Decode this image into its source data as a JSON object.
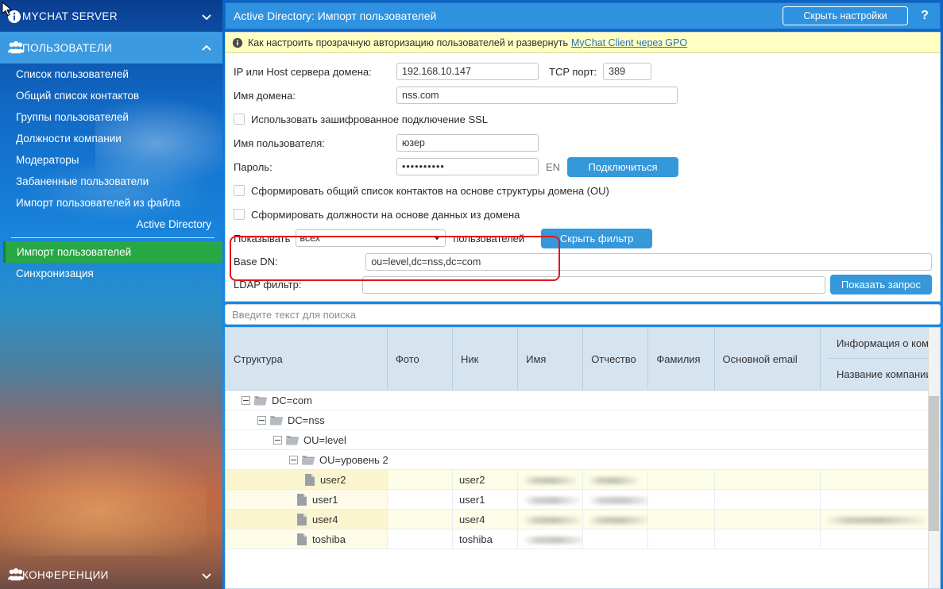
{
  "sidebar": {
    "server": {
      "label": "MYCHAT SERVER",
      "icon": "info-icon",
      "chevron": "chevron-down-icon"
    },
    "users_section": {
      "label": "ПОЛЬЗОВАТЕЛИ",
      "icon": "users-icon",
      "chevron": "chevron-up-icon"
    },
    "items": [
      {
        "label": "Список пользователей"
      },
      {
        "label": "Общий список контактов"
      },
      {
        "label": "Группы пользователей"
      },
      {
        "label": "Должности компании"
      },
      {
        "label": "Модераторы"
      },
      {
        "label": "Забаненные пользователи"
      },
      {
        "label": "Импорт пользователей из файла"
      }
    ],
    "group_label": "Active Directory",
    "ad_items": [
      {
        "label": "Импорт пользователей",
        "selected": true
      },
      {
        "label": "Синхронизация",
        "selected": false
      }
    ],
    "conferences": {
      "label": "КОНФЕРЕНЦИИ",
      "icon": "users-icon",
      "chevron": "chevron-down-icon"
    }
  },
  "titlebar": {
    "title": "Active Directory: Импорт пользователей",
    "hide_settings_label": "Скрыть настройки",
    "help_label": "?"
  },
  "infobar": {
    "icon": "info-icon",
    "text": "Как настроить прозрачную авторизацию пользователей и развернуть",
    "link": "MyChat Client через GPO"
  },
  "form": {
    "host_label": "IP или Host сервера домена:",
    "host_value": "192.168.10.147",
    "port_label": "TCP порт:",
    "port_value": "389",
    "domain_label": "Имя домена:",
    "domain_value": "nss.com",
    "ssl_label": "Использовать зашифрованное подключение SSL",
    "ssl_checked": false,
    "username_label": "Имя пользователя:",
    "username_value": "юзер",
    "password_label": "Пароль:",
    "password_value": "••••••••••",
    "keyboard_layout": "EN",
    "connect_label": "Подключиться",
    "contacts_ou_label": "Сформировать общий список контактов на основе структуры домена (OU)",
    "contacts_ou_checked": false,
    "positions_label": "Сформировать должности на основе данных из домена",
    "positions_checked": false,
    "show_prefix_label": "Показывать",
    "show_value": "всех",
    "show_options": [
      "всех"
    ],
    "show_suffix_label": "пользователей",
    "hide_filter_label": "Скрыть фильтр",
    "base_dn_label": "Base DN:",
    "base_dn_value": "ou=level,dc=nss,dc=com",
    "ldap_filter_label": "LDAP фильтр:",
    "ldap_filter_value": "",
    "show_query_label": "Показать запрос",
    "highlight_color": "#e4141b"
  },
  "search": {
    "placeholder": "Введите текст для поиска",
    "value": ""
  },
  "table": {
    "columns": [
      {
        "key": "structure",
        "label": "Структура"
      },
      {
        "key": "photo",
        "label": "Фото"
      },
      {
        "key": "nick",
        "label": "Ник"
      },
      {
        "key": "first",
        "label": "Имя"
      },
      {
        "key": "middle",
        "label": "Отчество"
      },
      {
        "key": "last",
        "label": "Фамилия"
      },
      {
        "key": "email",
        "label": "Основной email"
      }
    ],
    "grouped_column": {
      "group_label": "Информация о компани",
      "sub_label": "Название компании"
    },
    "rows": [
      {
        "type": "node",
        "depth": 0,
        "label": "DC=com",
        "icon": "folder-icon",
        "expanded": true
      },
      {
        "type": "node",
        "depth": 1,
        "label": "DC=nss",
        "icon": "folder-icon",
        "expanded": true
      },
      {
        "type": "node",
        "depth": 2,
        "label": "OU=level",
        "icon": "folder-icon",
        "expanded": true
      },
      {
        "type": "node",
        "depth": 3,
        "label": "OU=уровень 2",
        "icon": "folder-icon",
        "expanded": true
      },
      {
        "type": "leaf",
        "depth": 4,
        "label": "user2",
        "icon": "document-icon",
        "nick": "user2",
        "redacted": [
          1,
          1,
          0,
          0
        ]
      },
      {
        "type": "leaf",
        "depth": 4,
        "label": "user1",
        "icon": "document-icon",
        "nick": "user1",
        "redacted": [
          1,
          1,
          0,
          0
        ]
      },
      {
        "type": "leaf",
        "depth": 4,
        "label": "user4",
        "icon": "document-icon",
        "nick": "user4",
        "redacted": [
          1,
          1,
          0,
          1
        ]
      },
      {
        "type": "leaf",
        "depth": 4,
        "label": "toshiba",
        "icon": "document-icon",
        "nick": "toshiba",
        "redacted": [
          1,
          0,
          0,
          0
        ]
      }
    ]
  }
}
